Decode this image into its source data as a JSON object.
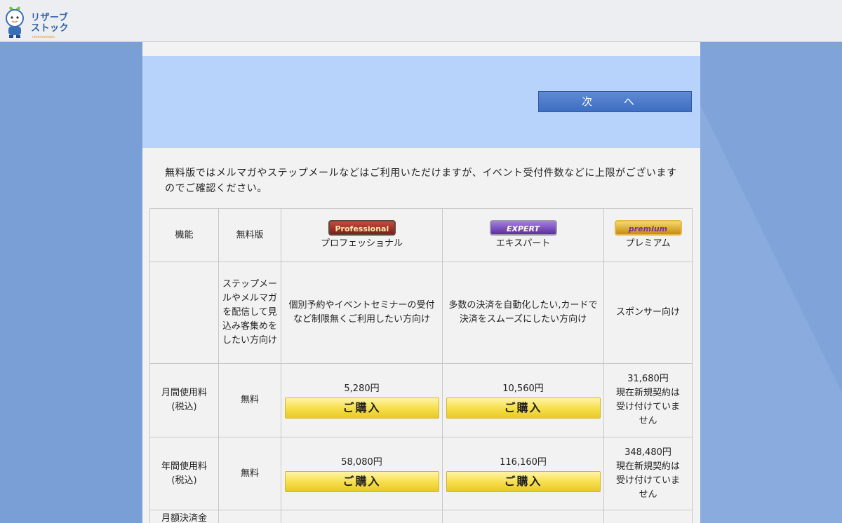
{
  "header": {
    "logo_text": "リザーブ\nストック",
    "logo_sub": "reservestock"
  },
  "banner": {
    "next_label": "次 へ"
  },
  "intro": "無料版ではメルマガやステップメールなどはご利用いただけますが、イベント受付件数などに上限がございますのでご確認ください。",
  "table": {
    "headers": {
      "feature": "機能",
      "free": "無料版",
      "pro_badge": "Professional",
      "pro": "プロフェッショナル",
      "expert_badge": "EXPERT",
      "expert": "エキスパート",
      "premium_badge": "premium",
      "premium": "プレミアム"
    },
    "target_row": {
      "free": "ステップメールやメルマガを配信して見込み客集めをしたい方向け",
      "pro": "個別予約やイベントセミナーの受付など制限無くご利用したい方向け",
      "expert": "多数の決済を自動化したい,カードで決済をスムーズにしたい方向け",
      "premium": "スポンサー向け"
    },
    "monthly_row": {
      "label": "月間使用料(税込)",
      "free": "無料",
      "pro_price": "5,280円",
      "expert_price": "10,560円",
      "premium_price": "31,680円",
      "premium_note": "現在新規契約は受け付けていません",
      "buy_label": "ご購入"
    },
    "yearly_row": {
      "label": "年間使用料(税込)",
      "free": "無料",
      "pro_price": "58,080円",
      "expert_price": "116,160円",
      "premium_price": "348,480円",
      "premium_note": "現在新規契約は受け付けていません",
      "buy_label": "ご購入"
    },
    "next_row": {
      "label": "月額決済金"
    }
  },
  "colors": {
    "background": "#7a9fd6",
    "banner": "#b8d3fb",
    "next_button": "#4a78c8",
    "buy_button": "#f7e04e"
  }
}
